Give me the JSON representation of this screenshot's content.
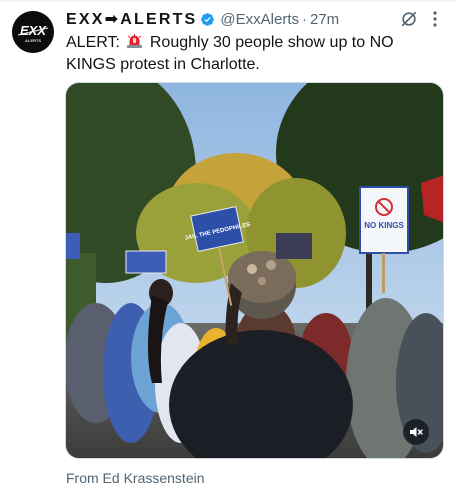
{
  "tweet": {
    "display_name": "EXX➡ALERTS",
    "handle": "@ExxAlerts",
    "separator": "·",
    "time": "27m",
    "text_prefix": "ALERT:",
    "text_body": "Roughly 30 people show up to NO KINGS protest in Charlotte.",
    "avatar_text": "EXX",
    "avatar_subtext": "ALERTS",
    "sign_left": "JAIL THE PEDOPHILES",
    "sign_right": "NO KINGS",
    "source": "From Ed Krassenstein"
  },
  "icons": {
    "verified": "verified-badge-icon",
    "grok": "grok-icon",
    "more": "more-options-icon",
    "siren": "siren-emoji-icon",
    "mute": "muted-speaker-icon"
  },
  "colors": {
    "verified_blue": "#1d9bf0",
    "text_primary": "#0f1419",
    "text_secondary": "#536471",
    "siren_red": "#e0282e",
    "sign_blue": "#2e4fa8"
  }
}
